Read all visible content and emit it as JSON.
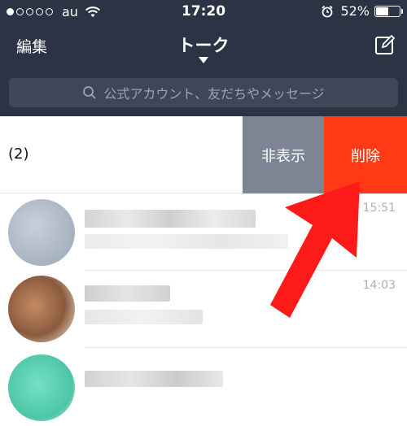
{
  "status_bar": {
    "carrier": "au",
    "time": "17:20",
    "battery": "52%",
    "signal_bars_filled": 1,
    "signal_bars_total": 5,
    "battery_level": 0.52
  },
  "nav": {
    "edit_label": "編集",
    "title": "トーク"
  },
  "search": {
    "placeholder": "公式アカウント、友だちやメッセージ"
  },
  "swiped_row": {
    "name": "(2)",
    "hide_label": "非表示",
    "delete_label": "削除"
  },
  "chats": [
    {
      "time": "15:51",
      "avatar_color": "#b4bfcc"
    },
    {
      "time": "14:03",
      "avatar_color": "#a86a48"
    },
    {
      "time": "",
      "avatar_color": "#5fd1b2"
    }
  ],
  "colors": {
    "header_bg": "#2b3344",
    "search_bg": "#3e4658",
    "hide_bg": "#7d8594",
    "delete_bg": "#ff3a14",
    "arrow": "#ff1a1a"
  }
}
